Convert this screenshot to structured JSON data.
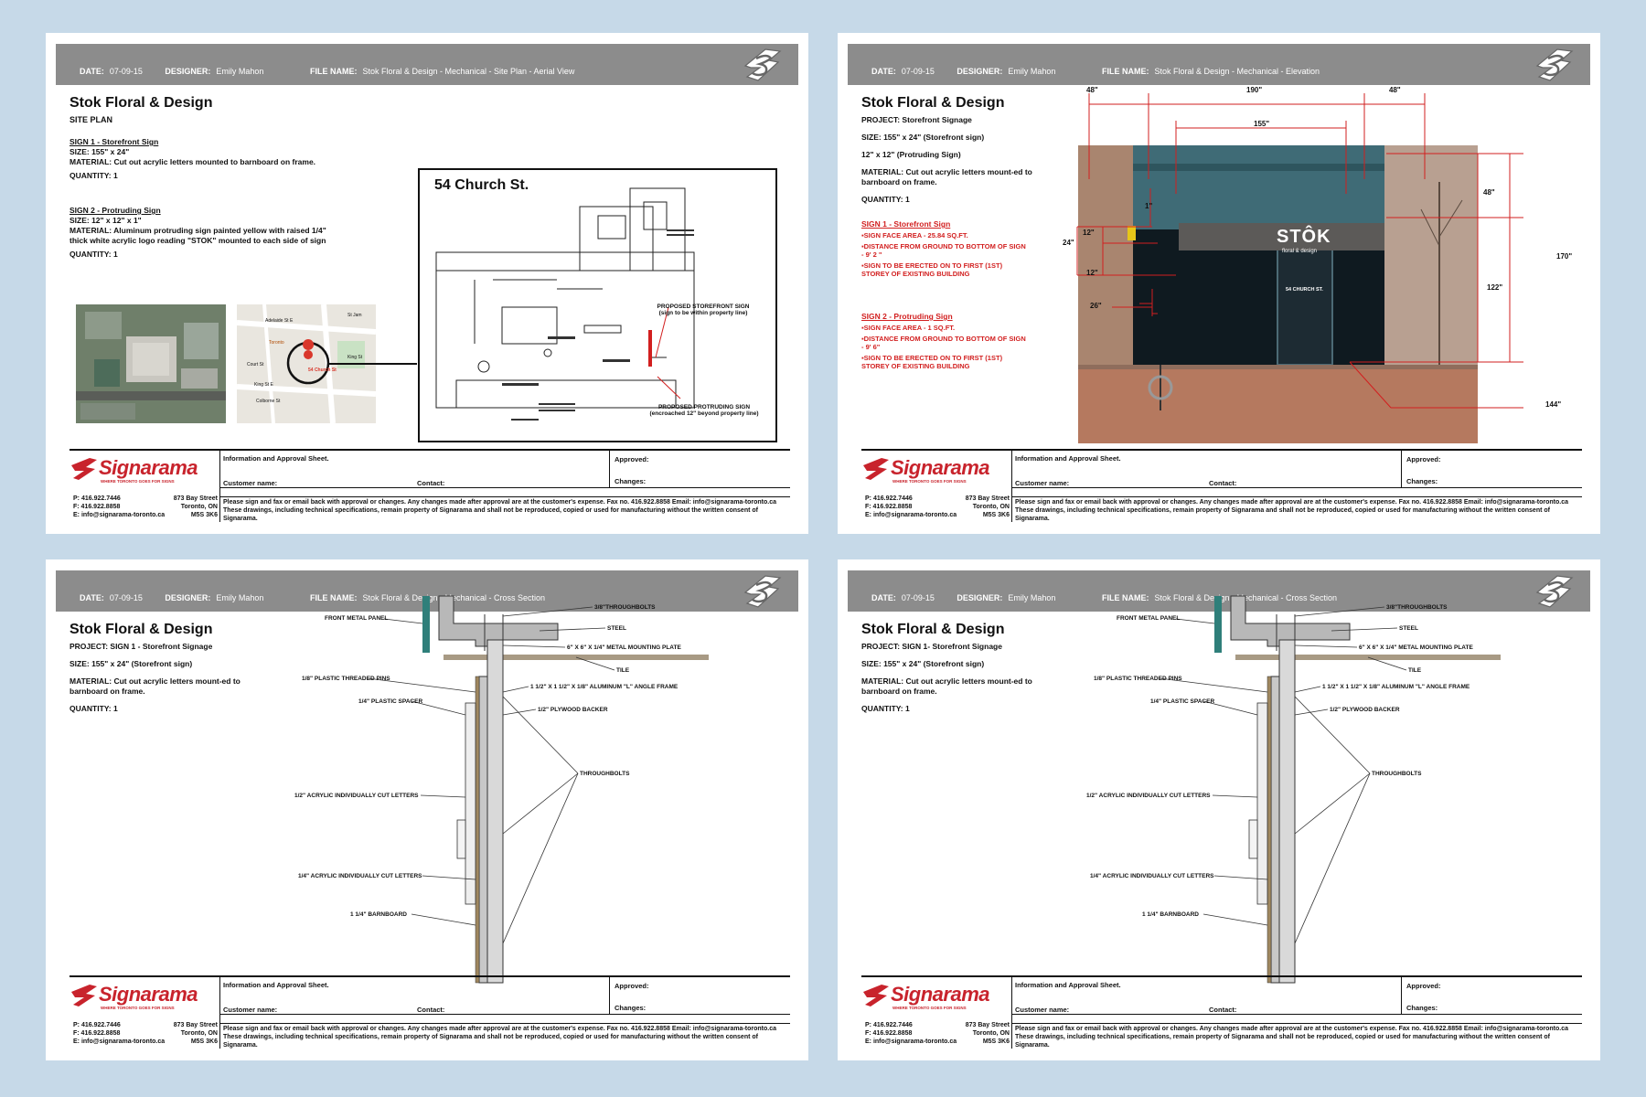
{
  "sheets": [
    {
      "header": {
        "date_label": "DATE:",
        "date": "07-09-15",
        "designer_label": "DESIGNER:",
        "designer": "Emily Mahon",
        "file_label": "FILE NAME:",
        "file": "Stok Floral & Design - Mechanical - Site Plan - Aerial View"
      },
      "title": "Stok Floral & Design",
      "subtitle": "SITE PLAN",
      "sign1_title": "SIGN 1 - Storefront Sign",
      "sign1_size": "SIZE: 155\" x 24\"",
      "sign1_material": "MATERIAL: Cut out acrylic letters mounted to barnboard on frame.",
      "sign1_qty": "QUANTITY: 1",
      "sign2_title": "SIGN 2 - Protruding Sign",
      "sign2_size": "SIZE: 12\" x 12\" x 1\"",
      "sign2_material": "MATERIAL: Aluminum protruding sign painted yellow with raised 1/4\" thick white acrylic logo reading \"STOK\" mounted to each side of sign",
      "sign2_qty": "QUANTITY: 1",
      "plan_title": "54 Church St.",
      "plan_note1": "PROPOSED STOREFRONT SIGN",
      "plan_note1b": "(sign to be within property line)",
      "plan_note2": "PROPOSED PROTRUDING SIGN",
      "plan_note2b": "(encroached 12\" beyond property line)",
      "map_labels": [
        "Adelaide St E",
        "Toronto",
        "King St E",
        "Court St",
        "54 Church St",
        "Colborne St",
        "St Jam",
        "King St"
      ]
    },
    {
      "header": {
        "date_label": "DATE:",
        "date": "07-09-15",
        "designer_label": "DESIGNER:",
        "designer": "Emily Mahon",
        "file_label": "FILE NAME:",
        "file": "Stok Floral & Design - Mechanical - Elevation"
      },
      "title": "Stok Floral & Design",
      "project": "PROJECT: Storefront Signage",
      "size1": "SIZE: 155\" x 24\" (Storefront sign)",
      "size2": "12\" x 12\" (Protruding Sign)",
      "material": "MATERIAL: Cut out acrylic letters mount-ed to barnboard on frame.",
      "qty": "QUANTITY: 1",
      "sign1_title": "SIGN 1 - Storefront Sign",
      "sign1_items": [
        "▪SIGN FACE AREA - 25.84 SQ.FT.",
        "▪DISTANCE FROM GROUND TO BOTTOM OF SIGN - 9' 2 \"",
        "▪SIGN TO BE ERECTED ON TO FIRST  (1ST) STOREY OF EXISTING BUILDING"
      ],
      "sign2_title": "SIGN 2 - Protruding Sign",
      "sign2_items": [
        "▪SIGN FACE AREA - 1 SQ.FT.",
        "▪DISTANCE FROM GROUND TO BOTTOM OF SIGN - 9' 6\"",
        "▪SIGN TO BE ERECTED ON TO FIRST  (1ST) STOREY OF EXISTING BUILDING"
      ],
      "dims": {
        "d48a": "48\"",
        "d190": "190\"",
        "d48b": "48\"",
        "d155": "155\"",
        "d1": "1\"",
        "d12a": "12\"",
        "d24": "24\"",
        "d12b": "12\"",
        "d26": "26\"",
        "d48c": "48\"",
        "d170": "170\"",
        "d122": "122\"",
        "d144": "144\""
      },
      "store_sign": "STÔK",
      "store_sign_sub": "floral & design",
      "door_text": "54 CHURCH ST."
    },
    {
      "header": {
        "date_label": "DATE:",
        "date": "07-09-15",
        "designer_label": "DESIGNER:",
        "designer": "Emily Mahon",
        "file_label": "FILE NAME:",
        "file": "Stok Floral & Design - Mechanical - Cross Section"
      },
      "title": "Stok Floral & Design",
      "project": "PROJECT: SIGN 1 - Storefront Signage",
      "size": "SIZE: 155\" x 24\" (Storefront sign)",
      "material": "MATERIAL: Cut out acrylic letters mount-ed to barnboard on frame.",
      "qty": "QUANTITY: 1"
    },
    {
      "header": {
        "date_label": "DATE:",
        "date": "07-09-15",
        "designer_label": "DESIGNER:",
        "designer": "Emily Mahon",
        "file_label": "FILE NAME:",
        "file": "Stok Floral & Design - Mechanical - Cross Section"
      },
      "title": "Stok Floral & Design",
      "project": "PROJECT: SIGN 1- Storefront Signage",
      "size": "SIZE: 155\" x 24\" (Storefront sign)",
      "material": "MATERIAL: Cut out acrylic letters mount-ed to barnboard on frame.",
      "qty": "QUANTITY: 1"
    }
  ],
  "section_labels": {
    "front_panel": "FRONT METAL PANEL",
    "throughbolts_top": "3/8\"THROUGHBOLTS",
    "steel": "STEEL",
    "plate": "6\" X 6\" X 1/4\" METAL MOUNTING PLATE",
    "tile": "TILE",
    "pins": "1/8\" PLASTIC THREADED PINS",
    "frame": "1 1/2\" X 1 1/2\" X 1/8\" ALUMINUM \"L\" ANGLE FRAME",
    "spacer": "1/4\" PLASTIC SPACER",
    "plywood": "1/2\" PLYWOOD BACKER",
    "throughbolts": "THROUGHBOLTS",
    "acrylic_half": "1/2\" ACRYLIC INDIVIDUALLY CUT LETTERS",
    "acrylic_quarter": "1/4\" ACRYLIC INDIVIDUALLY CUT LETTERS",
    "barnboard": "1 1/4\" BARNBOARD"
  },
  "footer": {
    "brand": "Signarama",
    "tagline": "WHERE TORONTO GOES FOR SIGNS",
    "info_title": "Information and Approval Sheet.",
    "approved": "Approved:",
    "changes": "Changes:",
    "customer": "Customer name:",
    "contact": "Contact:",
    "phone": "P: 416.922.7446",
    "fax": "F: 416.922.8858",
    "email": "E: info@signarama-toronto.ca",
    "addr1": "873 Bay Street",
    "addr2": "Toronto, ON",
    "addr3": "M5S 3K6",
    "fine1": "Please sign and fax or email back with approval or changes. Any changes made after approval are at the customer's expense. Fax no. 416.922.8858 Email: info@signarama-toronto.ca",
    "fine2": "These drawings, including technical specifications, remain property of Signarama and shall not be reproduced, copied or used for manufacturing without the written consent of Signarama."
  },
  "colors": {
    "header": "#8c8c8c",
    "accent_red": "#d21f1f",
    "brand_red": "#c8232c",
    "background": "#c6d9e8",
    "panel_teal": "#2f7f7a",
    "tile": "#a89a84"
  }
}
